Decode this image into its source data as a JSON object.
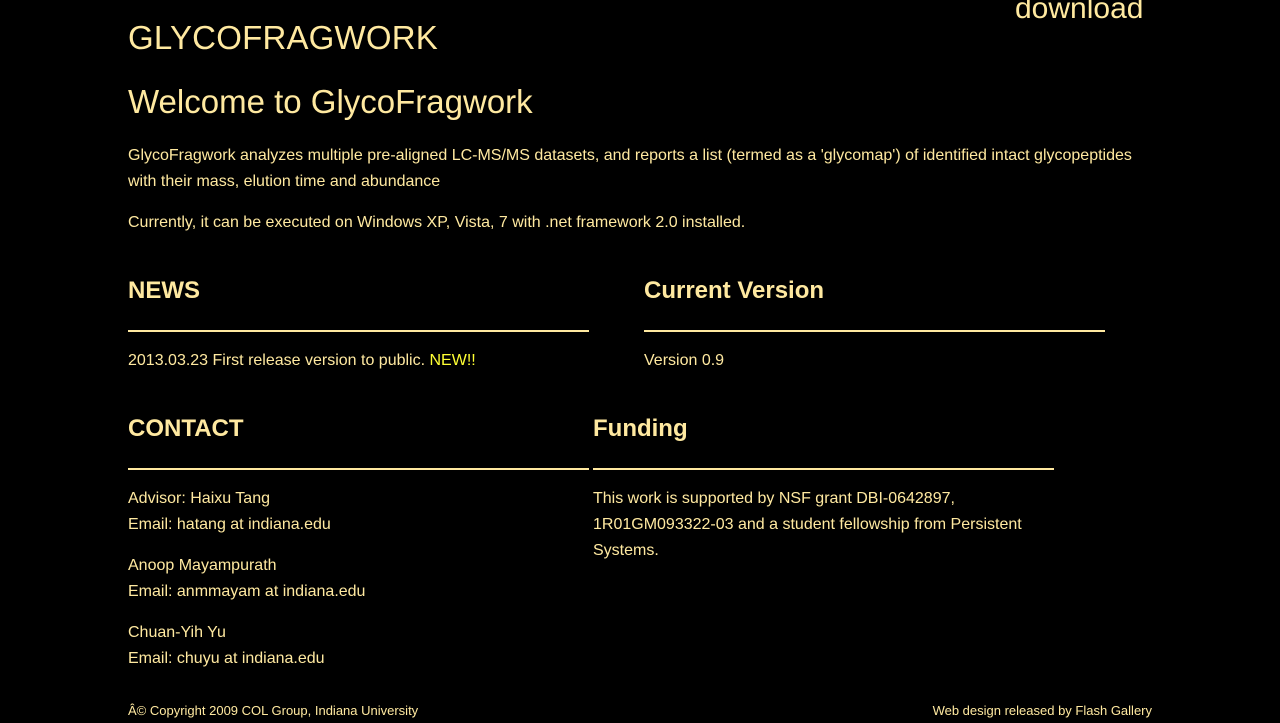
{
  "header": {
    "site_title": "GLYCOFRAGWORK",
    "download_label": "download"
  },
  "intro": {
    "heading": "Welcome to GlycoFragwork",
    "paragraph_1": "GlycoFragwork analyzes multiple pre-aligned LC-MS/MS datasets, and reports a list (termed as a 'glycomap') of identified intact glycopeptides with their mass, elution time and abundance",
    "paragraph_2": "Currently, it can be executed on Windows XP, Vista, 7 with .net framework 2.0 installed."
  },
  "news": {
    "heading": "NEWS",
    "items": [
      {
        "text": "2013.03.23 First release version to public. ",
        "badge": "NEW!!"
      }
    ]
  },
  "current_version": {
    "heading": "Current Version",
    "text": "Version 0.9"
  },
  "contact": {
    "heading": "CONTACT",
    "people": [
      {
        "name": "Advisor: Haixu Tang",
        "email": "Email: hatang at indiana.edu"
      },
      {
        "name": "Anoop Mayampurath",
        "email": "Email: anmmayam at indiana.edu"
      },
      {
        "name": "Chuan-Yih Yu",
        "email": "Email: chuyu at indiana.edu"
      }
    ]
  },
  "funding": {
    "heading": "Funding",
    "text": "This work is supported by NSF grant DBI-0642897, 1R01GM093322-03 and a student fellowship from Persistent Systems."
  },
  "footer": {
    "copyright": "Â© Copyright 2009 COL Group, Indiana University",
    "credit_prefix": "Web design released by ",
    "credit_link": "Flash Gallery"
  },
  "colors": {
    "background": "#000000",
    "text": "#ffe9a0",
    "badge": "#ffff33"
  }
}
